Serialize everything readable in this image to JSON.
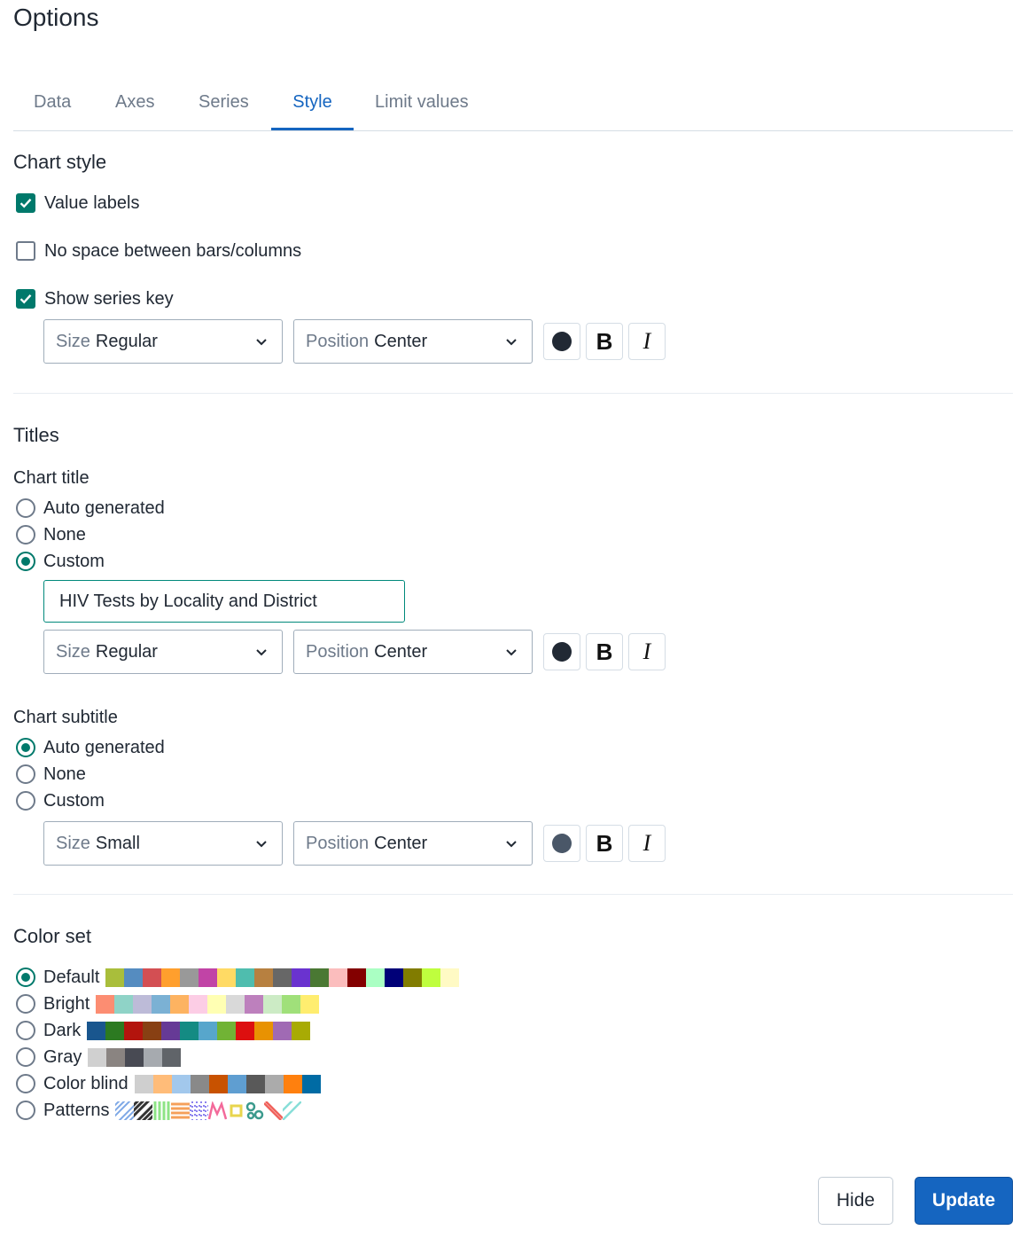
{
  "page_title": "Options",
  "tabs": [
    {
      "label": "Data"
    },
    {
      "label": "Axes"
    },
    {
      "label": "Series"
    },
    {
      "label": "Style",
      "active": true
    },
    {
      "label": "Limit values"
    }
  ],
  "chart_style": {
    "heading": "Chart style",
    "value_labels": {
      "label": "Value labels",
      "checked": true
    },
    "no_space": {
      "label": "No space between bars/columns",
      "checked": false
    },
    "series_key": {
      "label": "Show series key",
      "checked": true
    },
    "key_size": {
      "prefix": "Size",
      "value": "Regular"
    },
    "key_position": {
      "prefix": "Position",
      "value": "Center"
    },
    "key_color": "#212934"
  },
  "titles": {
    "heading": "Titles",
    "chart_title": {
      "label": "Chart title",
      "options": [
        "Auto generated",
        "None",
        "Custom"
      ],
      "selected": "Custom",
      "custom_value": "HIV Tests by Locality and District",
      "size": {
        "prefix": "Size",
        "value": "Regular"
      },
      "position": {
        "prefix": "Position",
        "value": "Center"
      },
      "color": "#212934"
    },
    "chart_subtitle": {
      "label": "Chart subtitle",
      "options": [
        "Auto generated",
        "None",
        "Custom"
      ],
      "selected": "Auto generated",
      "size": {
        "prefix": "Size",
        "value": "Small"
      },
      "position": {
        "prefix": "Position",
        "value": "Center"
      },
      "color": "#4a5768"
    }
  },
  "color_set": {
    "heading": "Color set",
    "selected": "Default",
    "sets": [
      {
        "name": "Default",
        "colors": [
          "#a9be3b",
          "#558cc0",
          "#d34f53",
          "#ff9f2d",
          "#999999",
          "#c144a6",
          "#ffda64",
          "#4fbdae",
          "#b78040",
          "#676767",
          "#6a33cf",
          "#4a7833",
          "#fbbdbd",
          "#830000",
          "#aaffc3",
          "#000078",
          "#817c00",
          "#bffe3e",
          "#fffac4"
        ]
      },
      {
        "name": "Bright",
        "colors": [
          "#fc8d72",
          "#8fd3c7",
          "#bdbbd8",
          "#7bb1d4",
          "#fdb361",
          "#fccde5",
          "#ffffb3",
          "#d9d9d9",
          "#bd80bd",
          "#ccebc5",
          "#a0e07a",
          "#ffed6f"
        ]
      },
      {
        "name": "Dark",
        "colors": [
          "#19568e",
          "#2c7a21",
          "#b3140d",
          "#884013",
          "#663a96",
          "#148b83",
          "#57a6cc",
          "#71b335",
          "#dd0f0f",
          "#e89202",
          "#a06ab4",
          "#a8ab04"
        ]
      },
      {
        "name": "Gray",
        "colors": [
          "#d0d0d0",
          "#8a8481",
          "#484a53",
          "#a6aaaf",
          "#606469"
        ]
      },
      {
        "name": "Color blind",
        "colors": [
          "#cfcfcf",
          "#ffbc79",
          "#a2c8ec",
          "#898989",
          "#c85200",
          "#5f9ed1",
          "#595959",
          "#ababab",
          "#ff800e",
          "#006ba4"
        ]
      },
      {
        "name": "Patterns",
        "colors": [
          "#7ea8e6",
          "#333333",
          "#8ee486",
          "#f5a05a",
          "#8c83ef",
          "#f36a9a",
          "#e8d54d",
          "#3b9a8d",
          "#f0625c",
          "#88ded8"
        ]
      }
    ]
  },
  "actions": {
    "hide": "Hide",
    "update": "Update"
  }
}
